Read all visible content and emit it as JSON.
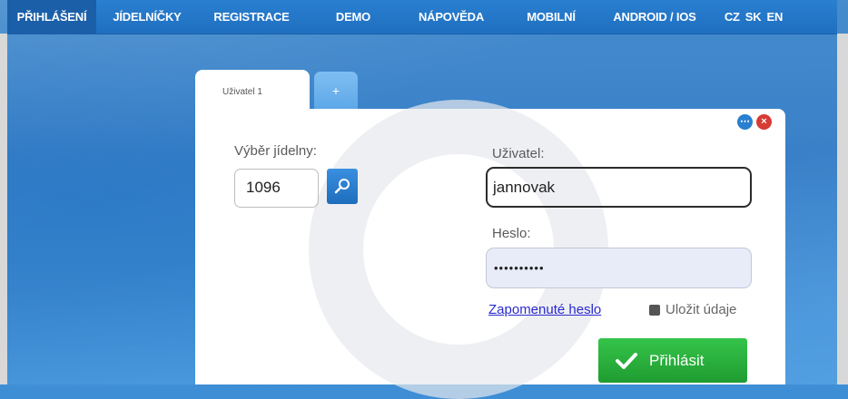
{
  "nav": {
    "items": [
      "PŘIHLÁŠENÍ",
      "JÍDELNÍČKY",
      "REGISTRACE",
      "DEMO",
      "NÁPOVĚDA",
      "MOBILNÍ",
      "ANDROID / IOS"
    ],
    "active_index": 0,
    "languages": [
      "CZ",
      "SK",
      "EN"
    ]
  },
  "tabs": {
    "active_label": "Uživatel 1",
    "add_label": "+"
  },
  "form": {
    "canteen_label": "Výběr jídelny:",
    "canteen_value": "1096",
    "user_label": "Uživatel:",
    "user_value": "jannovak",
    "password_label": "Heslo:",
    "password_value": "••••••••••",
    "forgot_link": "Zapomenuté heslo",
    "remember_label": "Uložit údaje",
    "login_button": "Přihlásit"
  },
  "icons": {
    "search": "search-icon",
    "more": "more-icon",
    "close": "close-icon",
    "check": "check-icon"
  },
  "colors": {
    "nav_bg": "#1f6fc0",
    "nav_active": "#1a5fa8",
    "button_green": "#1f9c30",
    "close_red": "#d83a34",
    "link_blue": "#2a2ad0"
  }
}
